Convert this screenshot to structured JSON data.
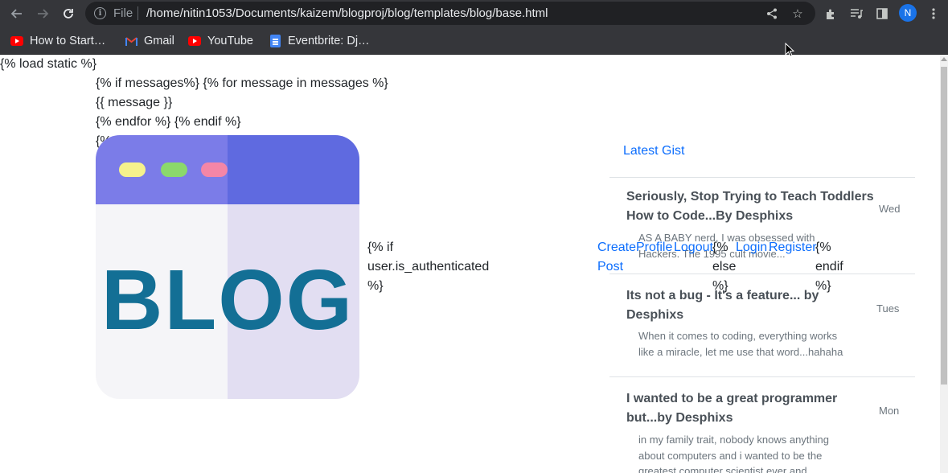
{
  "browser": {
    "file_label": "File",
    "url": "/home/nitin1053/Documents/kaizem/blogproj/blog/templates/blog/base.html",
    "avatar_initial": "N",
    "icons": [
      "back-arrow-icon",
      "forward-arrow-icon",
      "reload-icon",
      "info-icon",
      "share-icon",
      "star-icon",
      "extensions-icon",
      "media-icon",
      "sidepanel-icon",
      "more-icon"
    ]
  },
  "bookmarks": [
    {
      "label": "How to Start…",
      "icon": "youtube-icon"
    },
    {
      "label": "Gmail",
      "icon": "gmail-icon"
    },
    {
      "label": "YouTube",
      "icon": "youtube-icon"
    },
    {
      "label": "Eventbrite: Dj…",
      "icon": "docs-icon"
    }
  ],
  "page": {
    "template_lines": {
      "load_static": "{% load static %}",
      "if_messages": "{% if messages%} {% for message in messages %}",
      "message": "{{ message }}",
      "endfor": "{% endfor %} {% endif %}",
      "partial": "{%"
    },
    "logo": {
      "text": "BLOG"
    },
    "auth": {
      "if_line1": "{% if",
      "if_line2": "user.is_authenticated",
      "if_line3": "%}",
      "create_post_1": "Create",
      "create_post_2": "Post",
      "profile": "Profile",
      "logout": "Logout",
      "else_1": "{%",
      "else_2": "else",
      "else_3": "%}",
      "login": "Login",
      "register": "Register",
      "endif_1": "{%",
      "endif_2": "endif",
      "endif_3": "%}"
    },
    "gist": {
      "heading": "Latest Gist",
      "posts": [
        {
          "title": "Seriously, Stop Trying to Teach Toddlers How to Code...By Desphixs",
          "day": "Wed",
          "excerpt": "AS A BABY nerd, I was obsessed with Hackers. The 1995 cult movie..."
        },
        {
          "title": "Its not a bug - It's a feature... by Desphixs",
          "day": "Tues",
          "excerpt": "When it comes to coding, everything works like a miracle, let me use that word...hahaha"
        },
        {
          "title": "I wanted to be a great programmer but...by Desphixs",
          "day": "Mon",
          "excerpt": "in my family trait, nobody knows anything about computers and i wanted to be the greatest computer scientist ever and..."
        }
      ]
    }
  }
}
